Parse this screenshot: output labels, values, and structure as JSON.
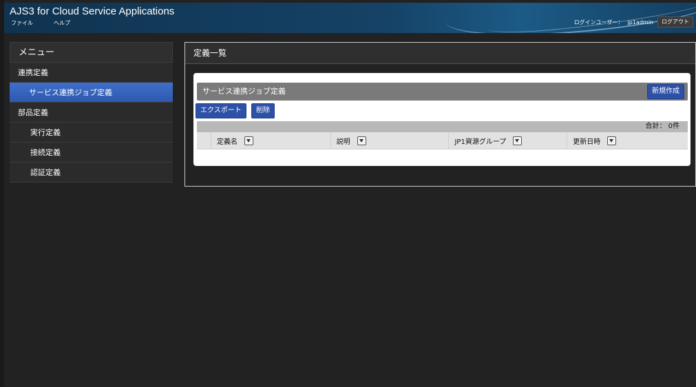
{
  "app": {
    "title": "AJS3 for Cloud Service Applications",
    "menu": [
      "ファイル",
      "ヘルプ"
    ],
    "login_label": "ログインユーザー：",
    "user": "jp1admin",
    "logout_label": "ログアウト"
  },
  "sidebar": {
    "header": "メニュー",
    "items": [
      {
        "label": "連携定義",
        "level": 1
      },
      {
        "label": "サービス連携ジョブ定義",
        "level": 2,
        "active": true
      },
      {
        "label": "部品定義",
        "level": 1
      },
      {
        "label": "実行定義",
        "level": 2
      },
      {
        "label": "接続定義",
        "level": 2
      },
      {
        "label": "認証定義",
        "level": 2
      }
    ]
  },
  "main": {
    "title": "定義一覧",
    "card": {
      "title": "サービス連携ジョブ定義",
      "new_button": "新規作成",
      "export_button": "エクスポート",
      "delete_button": "削除",
      "count": "合計：  0件",
      "columns": [
        "定義名",
        "説明",
        "JP1資源グループ",
        "更新日時"
      ]
    }
  },
  "colors": {
    "accent": "#2d51a6",
    "active_item": "#3f6fc9",
    "header_bg": "#154266",
    "background": "#222222"
  }
}
